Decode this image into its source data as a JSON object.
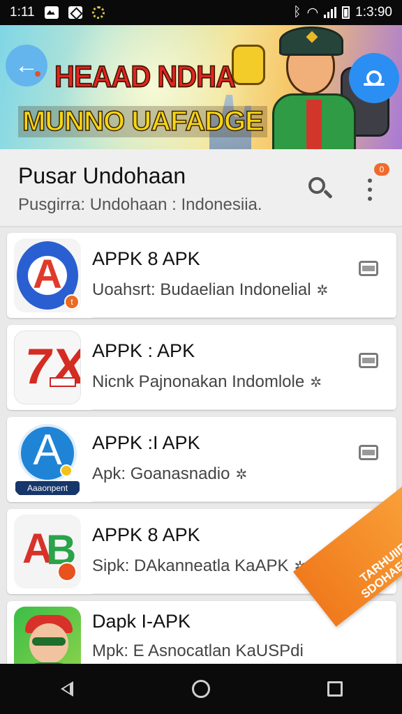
{
  "status_bar": {
    "time_left": "1:11",
    "time_right": "1:3:90"
  },
  "banner": {
    "line1": "HEAAD NDHA",
    "line2": "MUNNO UAFADGE"
  },
  "header": {
    "title": "Pusar Undohaan",
    "subtitle": "Pusgirra: Undohaan : Indonesiia.",
    "notification_count": "0"
  },
  "apps": [
    {
      "name": "APPK 8 APK",
      "desc": "Uoahsrt: Budaelian Indonelial"
    },
    {
      "name": "APPK : APK",
      "desc": "Nicnk Pajnonakan Indomlole"
    },
    {
      "name": "APPK :I APK",
      "desc": "Apk: Goanasnadio",
      "ribbon": "Aaaonpent"
    },
    {
      "name": "APPK 8 APK",
      "desc": "Sipk: DAkanneatla KaAPK"
    },
    {
      "name": "Dapk I-APK",
      "desc": "Mpk: E Asnocatlan KaUSPdi"
    }
  ],
  "icons": {
    "app1_letter": "A",
    "app1_badge": "t",
    "app2_letter": "7X",
    "app3_letter": "A",
    "app4_letter_a": "A",
    "app4_letter_b": "B"
  },
  "promo": {
    "line1": "TARHUIIFE",
    "line2": "SDOHAELALII"
  },
  "colors": {
    "accent": "#2b8ef2",
    "promo": "#f07a1d",
    "nav_bg": "#0b0b0b"
  }
}
